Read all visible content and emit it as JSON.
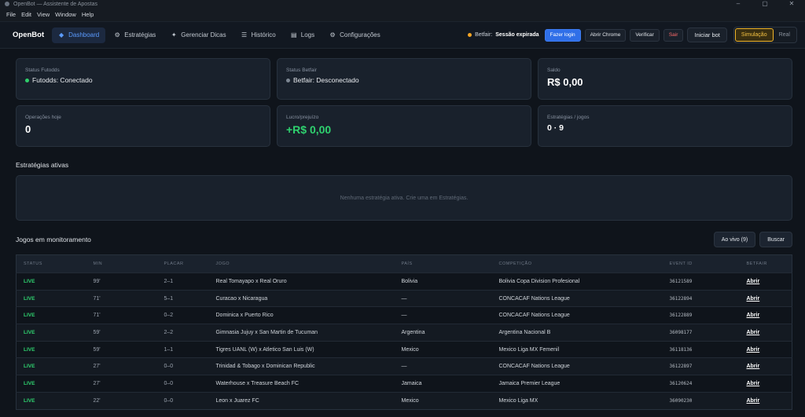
{
  "window": {
    "title": "OpenBot — Assistente de Apostas",
    "controls": [
      "–",
      "▢",
      "✕"
    ]
  },
  "menu": [
    "File",
    "Edit",
    "View",
    "Window",
    "Help"
  ],
  "nav": {
    "brand": "OpenBot",
    "items": [
      {
        "label": "Dashboard",
        "icon": "diamond-icon",
        "glyph": "◆",
        "active": true
      },
      {
        "label": "Estratégias",
        "icon": "gear-icon",
        "glyph": "⚙",
        "active": false
      },
      {
        "label": "Gerenciar Dicas",
        "icon": "sparkle-icon",
        "glyph": "✦",
        "active": false
      },
      {
        "label": "Histórico",
        "icon": "list-icon",
        "glyph": "☰",
        "active": false
      },
      {
        "label": "Logs",
        "icon": "log-icon",
        "glyph": "▤",
        "active": false
      },
      {
        "label": "Configurações",
        "icon": "settings-icon",
        "glyph": "⚙",
        "active": false
      }
    ],
    "betfair_label": "Betfair:",
    "betfair_status": "Sessão expirada",
    "buttons": {
      "login": "Fazer login",
      "chrome": "Abrir Chrome",
      "verify": "Verificar",
      "logout": "Sair",
      "start": "Iniciar bot"
    },
    "modes": [
      "Simulação",
      "Real"
    ],
    "active_mode": "Simulação"
  },
  "cards": {
    "futodds": {
      "label": "Status Futodds",
      "value": "Futodds: Conectado"
    },
    "betfair": {
      "label": "Status Betfair",
      "value": "Betfair: Desconectado"
    },
    "saldo": {
      "label": "Saldo",
      "value": "R$ 0,00"
    },
    "ops": {
      "label": "Operações hoje",
      "value": "0"
    },
    "lucro": {
      "label": "Lucro/prejuízo",
      "value": "+R$ 0,00"
    },
    "estrategias": {
      "label": "Estratégias / jogos",
      "value": "0 · 9"
    }
  },
  "strategies": {
    "title": "Estratégias ativas",
    "empty": "Nenhuma estratégia ativa. Crie uma em Estratégias."
  },
  "games": {
    "title": "Jogos em monitoramento",
    "live_button": "Ao vivo (9)",
    "search_button": "Buscar",
    "columns": [
      "STATUS",
      "MIN",
      "PLACAR",
      "JOGO",
      "PAÍS",
      "COMPETIÇÃO",
      "EVENT ID",
      "BETFAIR"
    ],
    "rows": [
      {
        "status": "LIVE",
        "min": "99'",
        "score": "2–1",
        "game": "Real Tomayapo x Real Oruro",
        "country": "Bolivia",
        "competition": "Bolivia Copa Division Profesional",
        "event_id": "36121589",
        "action": "Abrir"
      },
      {
        "status": "LIVE",
        "min": "71'",
        "score": "5–1",
        "game": "Curacao x Nicaragua",
        "country": "—",
        "competition": "CONCACAF Nations League",
        "event_id": "36122894",
        "action": "Abrir"
      },
      {
        "status": "LIVE",
        "min": "71'",
        "score": "0–2",
        "game": "Dominica x Puerto Rico",
        "country": "—",
        "competition": "CONCACAF Nations League",
        "event_id": "36122889",
        "action": "Abrir"
      },
      {
        "status": "LIVE",
        "min": "59'",
        "score": "2–2",
        "game": "Gimnasia Jujuy x San Martin de Tucuman",
        "country": "Argentina",
        "competition": "Argentina Nacional B",
        "event_id": "36098177",
        "action": "Abrir"
      },
      {
        "status": "LIVE",
        "min": "59'",
        "score": "1–1",
        "game": "Tigres UANL (W) x Atletico San Luis (W)",
        "country": "Mexico",
        "competition": "Mexico Liga MX Femenil",
        "event_id": "36118136",
        "action": "Abrir"
      },
      {
        "status": "LIVE",
        "min": "27'",
        "score": "0–0",
        "game": "Trinidad & Tobago x Dominican Republic",
        "country": "—",
        "competition": "CONCACAF Nations League",
        "event_id": "36122897",
        "action": "Abrir"
      },
      {
        "status": "LIVE",
        "min": "27'",
        "score": "0–0",
        "game": "Waterhouse x Treasure Beach FC",
        "country": "Jamaica",
        "competition": "Jamaica Premier League",
        "event_id": "36120624",
        "action": "Abrir"
      },
      {
        "status": "LIVE",
        "min": "22'",
        "score": "0–0",
        "game": "Leon x Juarez FC",
        "country": "Mexico",
        "competition": "Mexico Liga MX",
        "event_id": "36090230",
        "action": "Abrir"
      }
    ]
  },
  "colors": {
    "accent": "#2f6fe8",
    "live": "#2fd26f",
    "warning": "#f5a524",
    "mode": "#f0b429",
    "danger": "#ff6b6b"
  }
}
